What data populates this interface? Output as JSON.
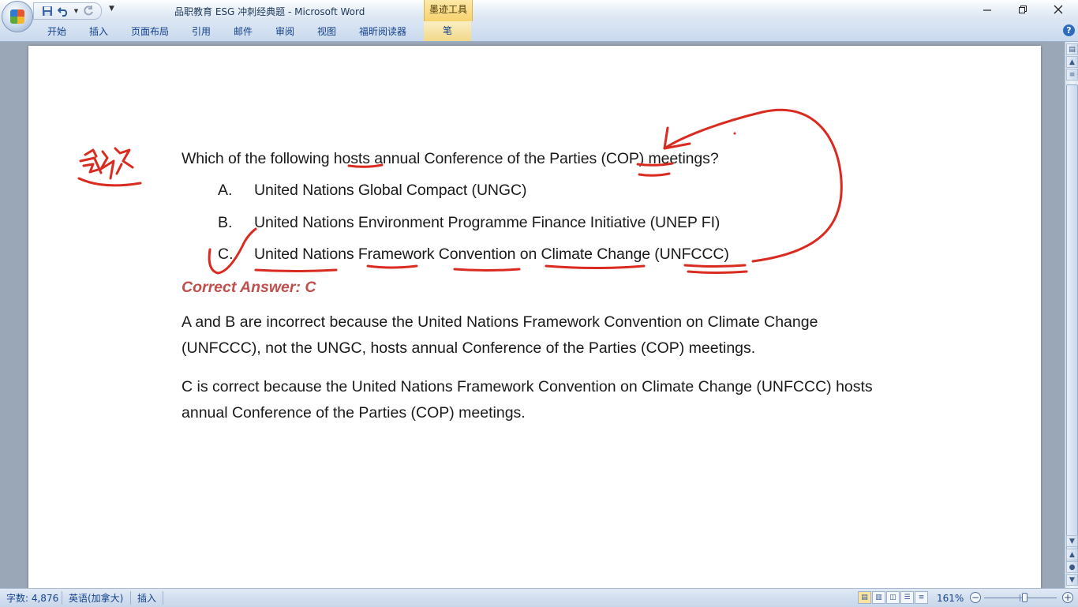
{
  "window": {
    "title": "品职教育 ESG 冲刺经典题 - Microsoft Word",
    "contextual_tab_group": "墨迹工具"
  },
  "ribbon": {
    "tabs": [
      {
        "label": "开始"
      },
      {
        "label": "插入"
      },
      {
        "label": "页面布局"
      },
      {
        "label": "引用"
      },
      {
        "label": "邮件"
      },
      {
        "label": "审阅"
      },
      {
        "label": "视图"
      },
      {
        "label": "福昕阅读器"
      }
    ],
    "contextual_tab": "笔"
  },
  "document": {
    "question": "Which of the following hosts annual Conference of the Parties (COP) meetings?",
    "options": [
      {
        "letter": "A.",
        "text": "United Nations Global Compact (UNGC)"
      },
      {
        "letter": "B.",
        "text": "United Nations Environment Programme Finance Initiative (UNEP FI)"
      },
      {
        "letter": "C.",
        "text": "United Nations Framework Convention on Climate Change (UNFCCC)"
      }
    ],
    "correct_answer": "Correct Answer: C",
    "explanations": [
      "A and B are incorrect because the United Nations Framework Convention on Climate Change (UNFCCC), not the UNGC, hosts annual Conference of the Parties (COP) meetings.",
      "C is correct because the United Nations Framework Convention on Climate Change (UNFCCC) hosts annual Conference of the Parties (COP) meetings."
    ]
  },
  "statusbar": {
    "word_count": "字数: 4,876",
    "language": "英语(加拿大)",
    "mode": "插入",
    "zoom": "161%",
    "zoom_level_percent": 161
  },
  "colors": {
    "ink": "#d92b20",
    "answer": "#c0504d",
    "ribbon_text": "#15428b"
  }
}
